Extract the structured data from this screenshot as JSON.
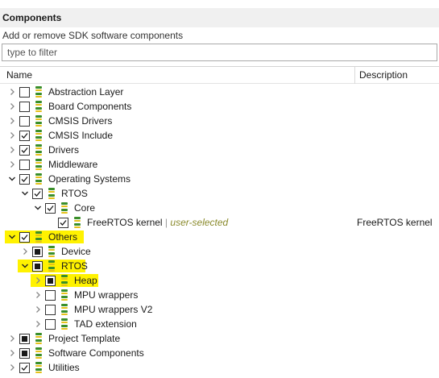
{
  "panel": {
    "title": "Components",
    "subtitle": "Add or remove SDK software components",
    "filter_placeholder": "type to filter"
  },
  "columns": {
    "name": "Name",
    "description": "Description"
  },
  "colors": {
    "highlight": "#fff200",
    "bundle_green": "#3a8f2a",
    "bundle_yellow": "#e6c21a",
    "user_selected_tag": "#8a8a2c"
  },
  "rows": [
    {
      "level": 0,
      "expanded": false,
      "state": "unchecked",
      "label": "Abstraction Layer",
      "tag": "",
      "description": "",
      "highlight": false
    },
    {
      "level": 0,
      "expanded": false,
      "state": "unchecked",
      "label": "Board Components",
      "tag": "",
      "description": "",
      "highlight": false
    },
    {
      "level": 0,
      "expanded": false,
      "state": "unchecked",
      "label": "CMSIS Drivers",
      "tag": "",
      "description": "",
      "highlight": false
    },
    {
      "level": 0,
      "expanded": false,
      "state": "checked",
      "label": "CMSIS Include",
      "tag": "",
      "description": "",
      "highlight": false
    },
    {
      "level": 0,
      "expanded": false,
      "state": "checked",
      "label": "Drivers",
      "tag": "",
      "description": "",
      "highlight": false
    },
    {
      "level": 0,
      "expanded": false,
      "state": "unchecked",
      "label": "Middleware",
      "tag": "",
      "description": "",
      "highlight": false
    },
    {
      "level": 0,
      "expanded": true,
      "state": "checked",
      "label": "Operating Systems",
      "tag": "",
      "description": "",
      "highlight": false
    },
    {
      "level": 1,
      "expanded": true,
      "state": "checked",
      "label": "RTOS",
      "tag": "",
      "description": "",
      "highlight": false
    },
    {
      "level": 2,
      "expanded": true,
      "state": "checked",
      "label": "Core",
      "tag": "",
      "description": "",
      "highlight": false
    },
    {
      "level": 3,
      "expanded": null,
      "state": "checked",
      "label": "FreeRTOS kernel",
      "tag": "user-selected",
      "description": "FreeRTOS kernel",
      "highlight": false
    },
    {
      "level": 0,
      "expanded": true,
      "state": "checked",
      "label": "Others",
      "tag": "",
      "description": "",
      "highlight": true
    },
    {
      "level": 1,
      "expanded": false,
      "state": "partial",
      "label": "Device",
      "tag": "",
      "description": "",
      "highlight": false
    },
    {
      "level": 1,
      "expanded": true,
      "state": "partial",
      "label": "RTOS",
      "tag": "",
      "description": "",
      "highlight": true
    },
    {
      "level": 2,
      "expanded": false,
      "state": "partial",
      "label": "Heap",
      "tag": "",
      "description": "",
      "highlight": true
    },
    {
      "level": 2,
      "expanded": false,
      "state": "unchecked",
      "label": "MPU wrappers",
      "tag": "",
      "description": "",
      "highlight": false
    },
    {
      "level": 2,
      "expanded": false,
      "state": "unchecked",
      "label": "MPU wrappers V2",
      "tag": "",
      "description": "",
      "highlight": false
    },
    {
      "level": 2,
      "expanded": false,
      "state": "unchecked",
      "label": "TAD extension",
      "tag": "",
      "description": "",
      "highlight": false
    },
    {
      "level": 0,
      "expanded": false,
      "state": "partial",
      "label": "Project Template",
      "tag": "",
      "description": "",
      "highlight": false
    },
    {
      "level": 0,
      "expanded": false,
      "state": "partial",
      "label": "Software Components",
      "tag": "",
      "description": "",
      "highlight": false
    },
    {
      "level": 0,
      "expanded": false,
      "state": "checked",
      "label": "Utilities",
      "tag": "",
      "description": "",
      "highlight": false
    }
  ]
}
